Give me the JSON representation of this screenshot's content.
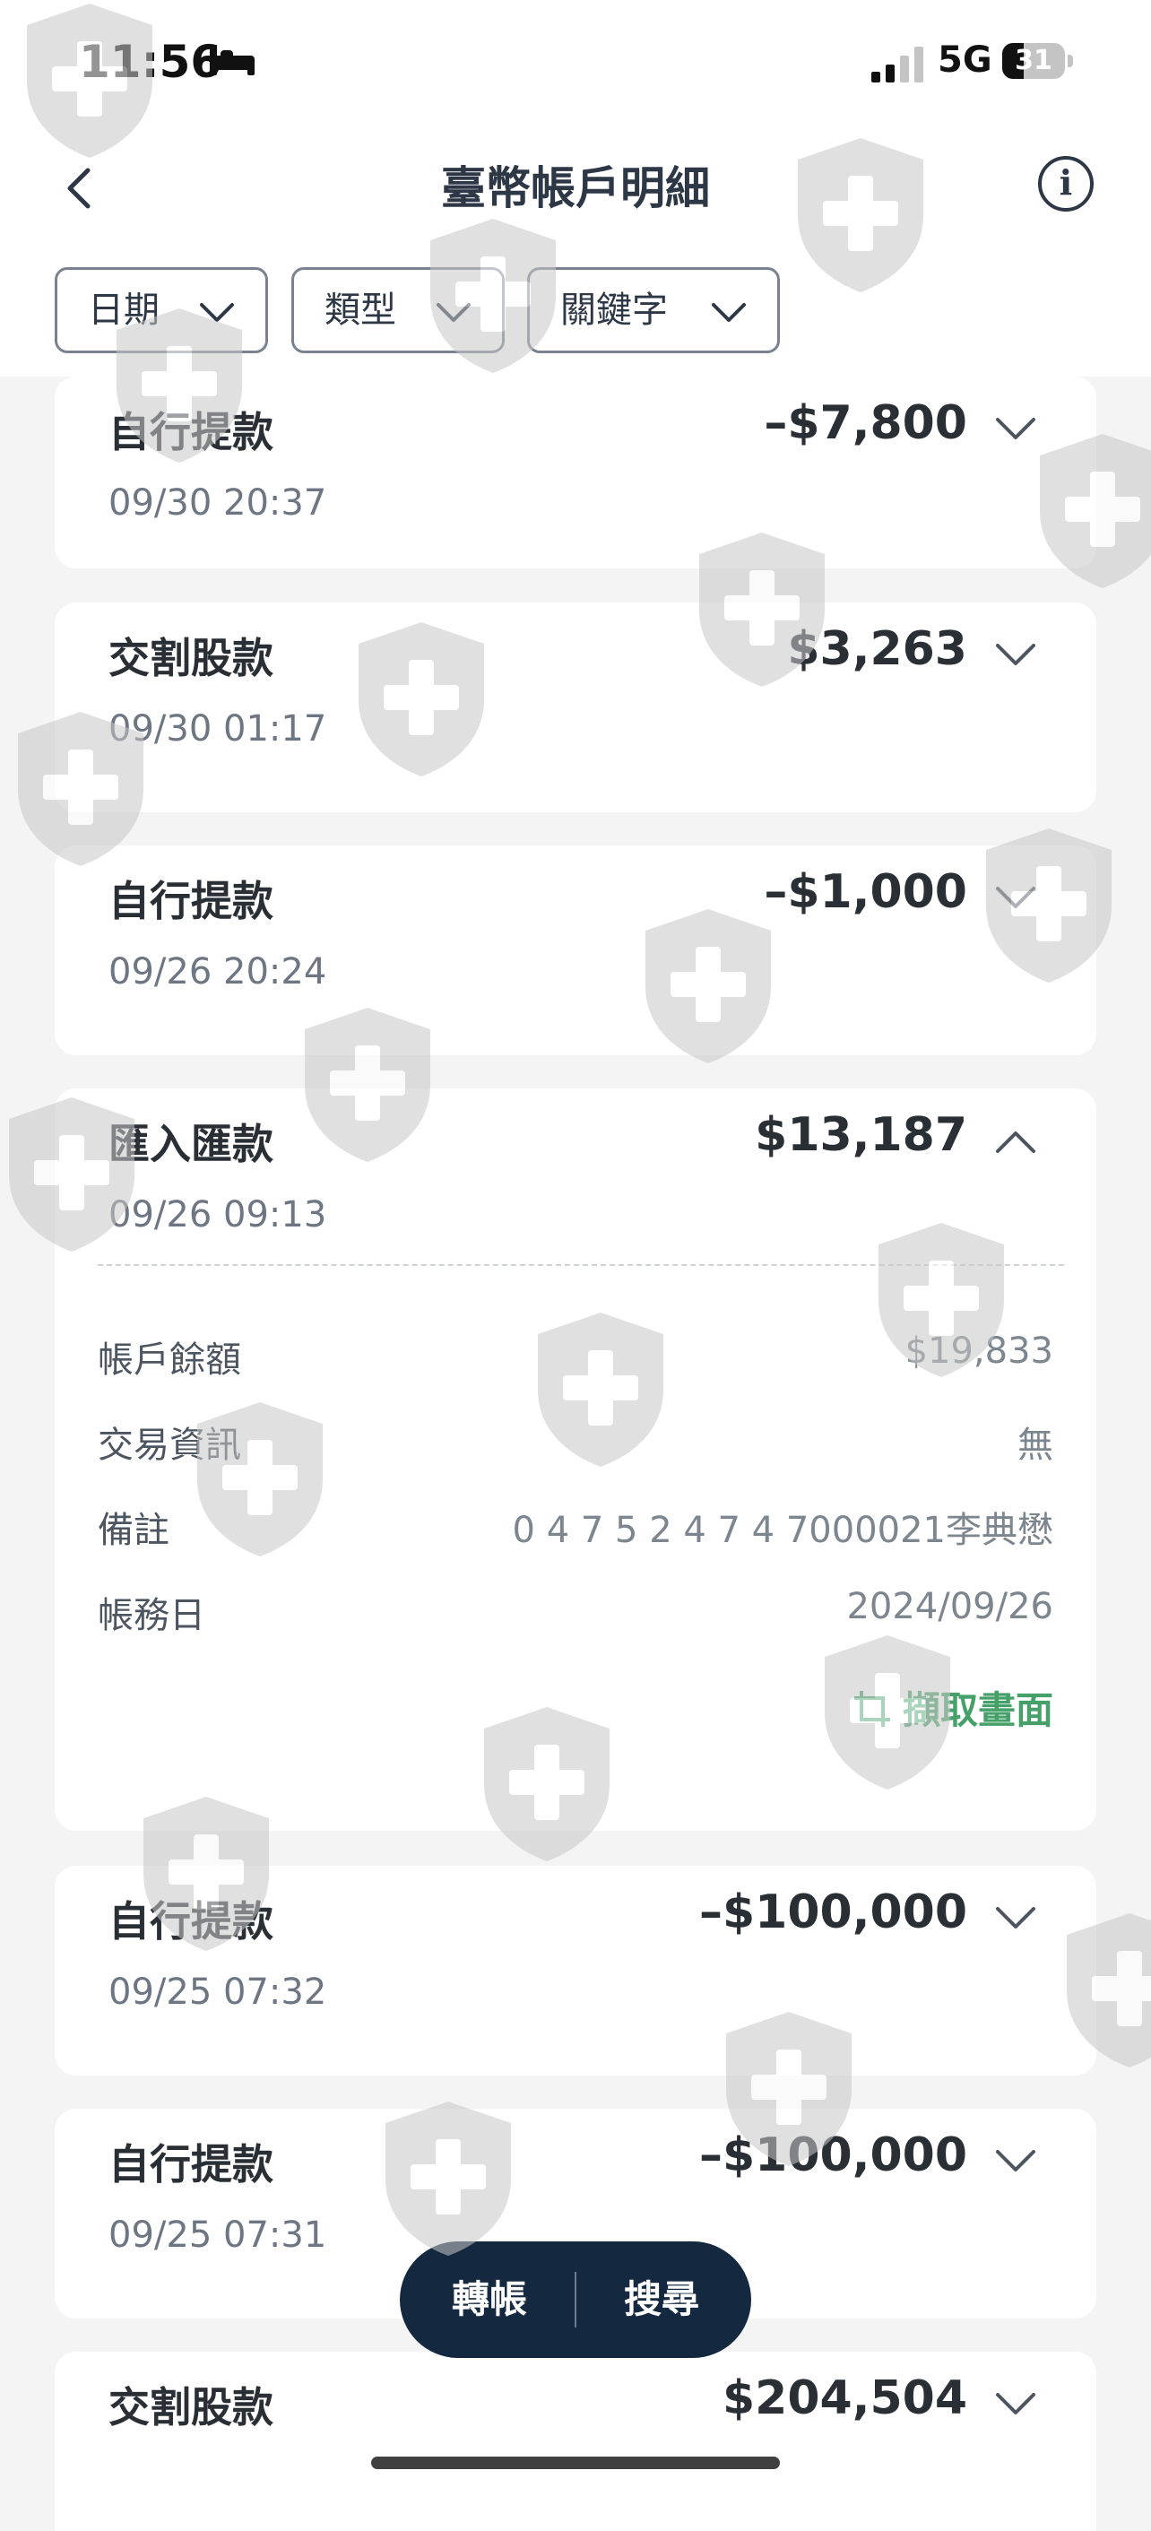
{
  "status_bar": {
    "time": "11:56",
    "network": "5G",
    "battery": "31",
    "icons": [
      "bed-icon",
      "signal-icon",
      "battery-icon"
    ]
  },
  "header": {
    "title": "臺幣帳戶明細",
    "back_icon": "chevron-left-icon",
    "info_icon": "info-icon",
    "info_glyph": "i"
  },
  "filters": [
    {
      "label": "日期",
      "icon": "chevron-down-icon"
    },
    {
      "label": "類型",
      "icon": "chevron-down-icon"
    },
    {
      "label": "關鍵字",
      "icon": "chevron-down-icon"
    }
  ],
  "transactions": [
    {
      "type": "自行提款",
      "date": "09/30 20:37",
      "amount": "–$7,800",
      "expanded": false
    },
    {
      "type": "交割股款",
      "date": "09/30 01:17",
      "amount": "$3,263",
      "expanded": false
    },
    {
      "type": "自行提款",
      "date": "09/26 20:24",
      "amount": "–$1,000",
      "expanded": false
    },
    {
      "type": "匯入匯款",
      "date": "09/26 09:13",
      "amount": "$13,187",
      "expanded": true,
      "details": [
        {
          "label": "帳戶餘額",
          "value": "$19,833"
        },
        {
          "label": "交易資訊",
          "value": "無"
        },
        {
          "label": "備註",
          "value": "0 4 7 5 2 4 7 4 7000021李典懋"
        },
        {
          "label": "帳務日",
          "value": "2024/09/26"
        }
      ],
      "capture_label": "擷取畫面",
      "capture_icon": "crop-icon"
    },
    {
      "type": "自行提款",
      "date": "09/25 07:32",
      "amount": "–$100,000",
      "expanded": false
    },
    {
      "type": "自行提款",
      "date": "09/25 07:31",
      "amount": "–$100,000",
      "expanded": false
    },
    {
      "type": "交割股款",
      "date": "",
      "amount": "$204,504",
      "expanded": false
    }
  ],
  "floating_bar": {
    "transfer_label": "轉帳",
    "search_label": "搜尋"
  },
  "colors": {
    "accent_green": "#46a06a",
    "pill_bg": "#14283f",
    "text_dark": "#2a2f36",
    "background": "#f4f4f5"
  },
  "watermark_icon": "shield-plus-icon"
}
